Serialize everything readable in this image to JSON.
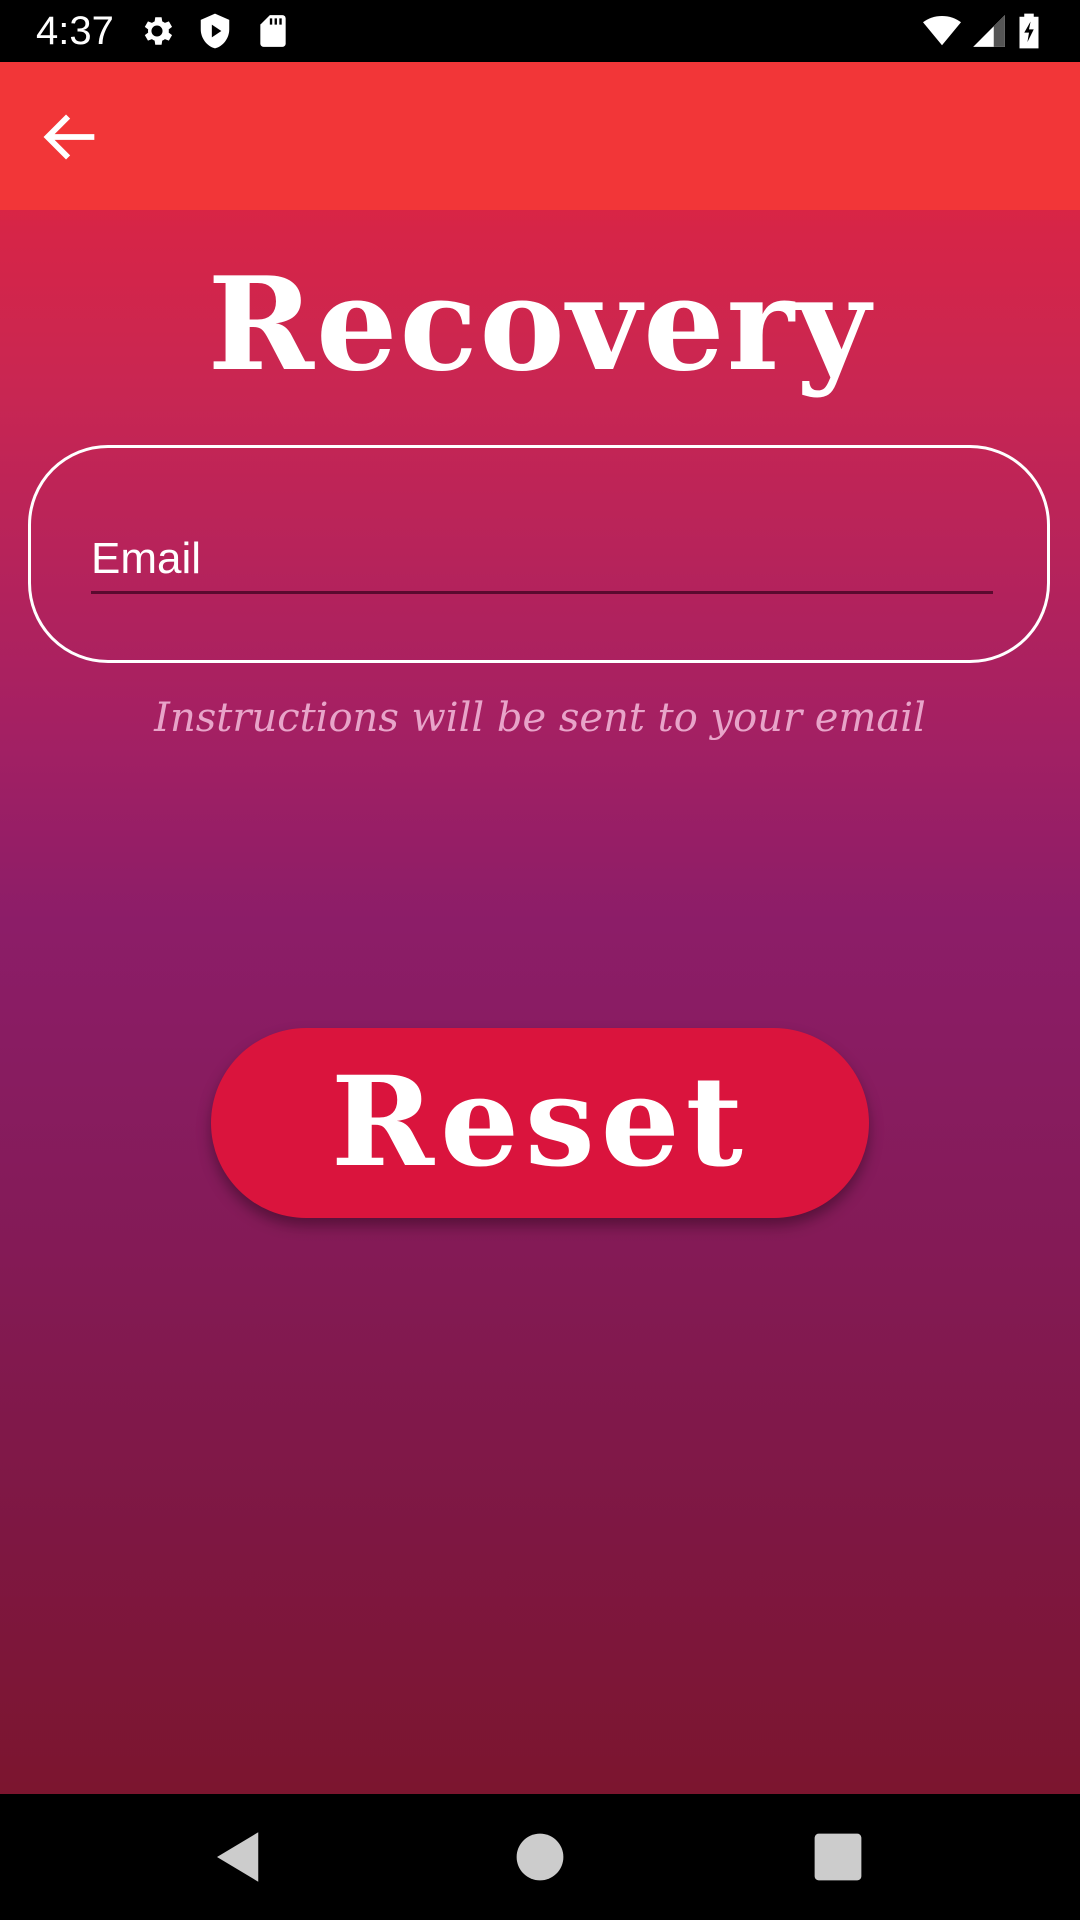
{
  "status_bar": {
    "time": "4:37",
    "icons": [
      "gear-icon",
      "shield-play-icon",
      "sd-card-icon",
      "wifi-icon",
      "cell-signal-icon",
      "battery-charging-icon"
    ]
  },
  "app_bar": {
    "back_icon": "arrow-back-icon",
    "color": "#f23638"
  },
  "main": {
    "title": "Recovery",
    "email_placeholder": "Email",
    "email_value": "",
    "instructions": "Instructions will be sent to your email",
    "reset_label": "Reset"
  },
  "nav_bar": {
    "icons": [
      "back-triangle-icon",
      "home-circle-icon",
      "recents-square-icon"
    ]
  },
  "colors": {
    "gradient_top": "#ea2337",
    "gradient_mid": "#8c1d68",
    "gradient_bottom": "#7b1425",
    "button": "#da143d",
    "instructions_text": "#e8a4c9"
  }
}
